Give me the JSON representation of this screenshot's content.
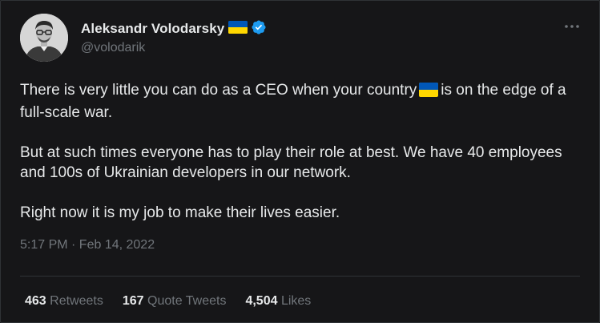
{
  "author": {
    "display_name": "Aleksandr Volodarsky",
    "handle": "@volodarik",
    "flag_icon": "ukraine-flag-icon",
    "verified_icon": "verified-badge-icon",
    "verified_color": "#1d9bf0"
  },
  "menu_icon": "more-options-icon",
  "tweet": {
    "line1_before_flag": "There is very little you can do as a CEO when your country",
    "line1_after_flag": "is on the edge of a full-scale war.",
    "paragraph2": "But at such times everyone has to play their role at best. We have 40 employees and 100s of Ukrainian developers in our network.",
    "paragraph3": "Right now it is my job to make their lives easier.",
    "timestamp": "5:17 PM · Feb 14, 2022"
  },
  "stats": {
    "retweets": {
      "count": "463",
      "label": "Retweets"
    },
    "quote_tweets": {
      "count": "167",
      "label": "Quote Tweets"
    },
    "likes": {
      "count": "4,504",
      "label": "Likes"
    }
  },
  "colors": {
    "background": "#161618",
    "text": "#e7e9ea",
    "muted": "#71767b",
    "flag_blue": "#0057b7",
    "flag_yellow": "#ffd700"
  }
}
